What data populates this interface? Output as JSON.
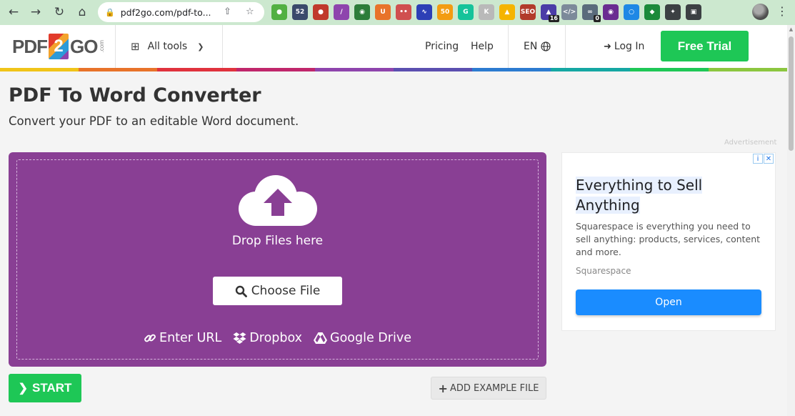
{
  "browser": {
    "url": "pdf2go.com/pdf-to...",
    "extensions": [
      {
        "name": "lightbulb-ext-icon",
        "color": "#52b043",
        "glyph": "●",
        "badge": ""
      },
      {
        "name": "counter-ext-icon",
        "color": "#3a4a6b",
        "glyph": "52",
        "badge": ""
      },
      {
        "name": "adblock-ext-icon",
        "color": "#c0392b",
        "glyph": "●",
        "badge": ""
      },
      {
        "name": "feather-ext-icon",
        "color": "#8e44ad",
        "glyph": "∕",
        "badge": ""
      },
      {
        "name": "globe-ext-icon",
        "color": "#2c7d3a",
        "glyph": "◉",
        "badge": ""
      },
      {
        "name": "u-ext-icon",
        "color": "#e8732a",
        "glyph": "U",
        "badge": ""
      },
      {
        "name": "dots-ext-icon",
        "color": "#d04f4f",
        "glyph": "••",
        "badge": ""
      },
      {
        "name": "chart-ext-icon",
        "color": "#2d3fb6",
        "glyph": "∿",
        "badge": ""
      },
      {
        "name": "seo-ext-icon",
        "color": "#f39c12",
        "glyph": "50",
        "badge": ""
      },
      {
        "name": "grammarly-ext-icon",
        "color": "#15c39a",
        "glyph": "G",
        "badge": ""
      },
      {
        "name": "k-ext-icon",
        "color": "#b9b9b9",
        "glyph": "K",
        "badge": ""
      },
      {
        "name": "bell-ext-icon",
        "color": "#f5b400",
        "glyph": "▲",
        "badge": ""
      },
      {
        "name": "seo-tools-ext-icon",
        "color": "#b23b2b",
        "glyph": "SEO",
        "badge": ""
      },
      {
        "name": "cap-ext-icon",
        "color": "#4b3ca7",
        "glyph": "▲",
        "badge": "16"
      },
      {
        "name": "code-ext-icon",
        "color": "#7c8a9a",
        "glyph": "</>",
        "badge": ""
      },
      {
        "name": "link-ext-icon",
        "color": "#5a6b7c",
        "glyph": "∞",
        "badge": "0"
      },
      {
        "name": "color-ext-icon",
        "color": "#6a2c91",
        "glyph": "◉",
        "badge": ""
      },
      {
        "name": "circle-ext-icon",
        "color": "#1e88e5",
        "glyph": "○",
        "badge": ""
      },
      {
        "name": "android-ext-icon",
        "color": "#1b8a3a",
        "glyph": "◆",
        "badge": ""
      },
      {
        "name": "puzzle-ext-icon",
        "color": "#3c4043",
        "glyph": "✦",
        "badge": ""
      },
      {
        "name": "sidepanel-ext-icon",
        "color": "#3c4043",
        "glyph": "▣",
        "badge": ""
      }
    ]
  },
  "header": {
    "logo_left": "PDF",
    "logo_two": "2",
    "logo_right": "GO",
    "logo_com": ".com",
    "all_tools": "All tools",
    "pricing": "Pricing",
    "help": "Help",
    "language": "EN",
    "login": "Log In",
    "free_trial": "Free Trial",
    "rainbow": [
      "#f0c419",
      "#e8732a",
      "#e0323d",
      "#c0266b",
      "#8e44ad",
      "#5b4fb0",
      "#2c7bd0",
      "#15a7a3",
      "#1ec756",
      "#8cc63f"
    ]
  },
  "main": {
    "title": "PDF To Word Converter",
    "subtitle": "Convert your PDF to an editable Word document.",
    "drop_text": "Drop Files here",
    "choose_file": "Choose File",
    "enter_url": "Enter URL",
    "dropbox": "Dropbox",
    "google_drive": "Google Drive",
    "start": "START",
    "add_example": "ADD EXAMPLE FILE"
  },
  "ad": {
    "label": "Advertisement",
    "title_line1": "Everything to Sell",
    "title_line2": "Anything",
    "description": "Squarespace is everything you need to sell anything: products, services, content and more.",
    "brand": "Squarespace",
    "cta": "Open"
  }
}
